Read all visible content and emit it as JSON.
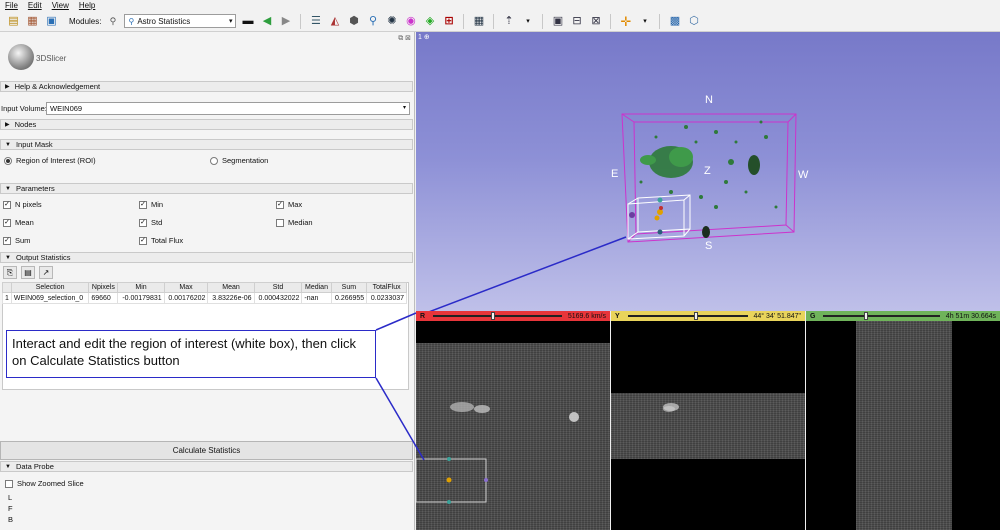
{
  "menu": [
    "File",
    "Edit",
    "View",
    "Help"
  ],
  "toolbar": {
    "modules_label": "Modules:",
    "module_selected": "Astro Statistics"
  },
  "logo_text": "3DSlicer",
  "sections": {
    "help": "Help & Acknowledgement",
    "nodes": "Nodes",
    "input_mask": "Input Mask",
    "parameters": "Parameters",
    "output_statistics": "Output Statistics",
    "data_probe": "Data Probe"
  },
  "input_volume": {
    "label": "Input Volume:",
    "value": "WEIN069"
  },
  "mask_options": {
    "roi": "Region of Interest (ROI)",
    "segmentation": "Segmentation",
    "selected": "roi"
  },
  "parameters": [
    {
      "label": "N pixels",
      "checked": true
    },
    {
      "label": "Min",
      "checked": true
    },
    {
      "label": "Max",
      "checked": true
    },
    {
      "label": "Mean",
      "checked": true
    },
    {
      "label": "Std",
      "checked": true
    },
    {
      "label": "Median",
      "checked": false
    },
    {
      "label": "Sum",
      "checked": true
    },
    {
      "label": "Total Flux",
      "checked": true
    }
  ],
  "table": {
    "headers": [
      "",
      "Selection",
      "Npixels",
      "Min",
      "Max",
      "Mean",
      "Std",
      "Median",
      "Sum",
      "TotalFlux"
    ],
    "rows": [
      [
        "1",
        "WEIN069_selection_0",
        "69660",
        "-0.00179831",
        "0.00176202",
        "3.83226e-06",
        "0.000432022",
        "-nan",
        "0.266955",
        "0.0233037"
      ]
    ]
  },
  "calculate_button": "Calculate Statistics",
  "data_probe": {
    "show_zoomed": "Show Zoomed Slice",
    "lines": [
      "L",
      "F",
      "B"
    ]
  },
  "view3d": {
    "tag": "1",
    "north": "N",
    "south": "S",
    "east": "E",
    "west": "W",
    "z": "Z"
  },
  "slices": {
    "red": {
      "label": "R",
      "value": "5169.6 km/s",
      "color": "#e8353a"
    },
    "yellow": {
      "label": "Y",
      "value": "44° 34' 51.847\"",
      "color": "#e9d45b"
    },
    "green": {
      "label": "G",
      "value": "4h 51m 30.664s",
      "color": "#6fb35a"
    }
  },
  "annotation": "Interact and edit the region of interest (white box), then click on Calculate Statistics button",
  "colors": {
    "view3d_top": "#7779c9",
    "roi_box": "#cc33cc",
    "callout_border": "#2b2bc8"
  }
}
